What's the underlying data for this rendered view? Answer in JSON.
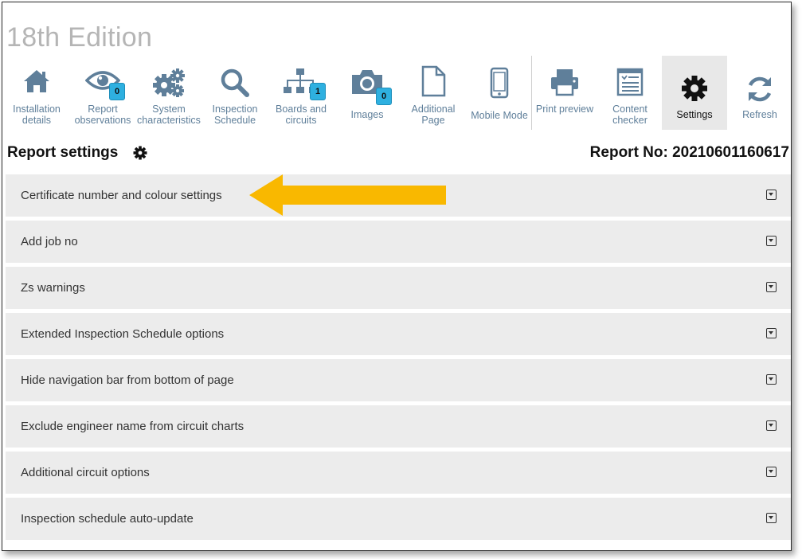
{
  "app": {
    "edition": "18th Edition"
  },
  "toolbar": {
    "items": [
      {
        "id": "installation",
        "label": "Installation details",
        "icon": "home-icon"
      },
      {
        "id": "observations",
        "label": "Report observations",
        "icon": "eye-icon",
        "badge": "0"
      },
      {
        "id": "system",
        "label": "System characteristics",
        "icon": "gears-icon"
      },
      {
        "id": "inspection",
        "label": "Inspection Schedule",
        "icon": "search-icon"
      },
      {
        "id": "boards",
        "label": "Boards and circuits",
        "icon": "sitemap-icon",
        "badge": "1"
      },
      {
        "id": "images",
        "label": "Images",
        "icon": "camera-icon",
        "badge": "0"
      },
      {
        "id": "additional",
        "label": "Additional Page",
        "icon": "page-icon"
      },
      {
        "id": "mobile",
        "label": "Mobile Mode",
        "icon": "mobile-icon"
      },
      {
        "id": "print",
        "label": "Print preview",
        "icon": "printer-icon"
      },
      {
        "id": "content",
        "label": "Content checker",
        "icon": "checklist-icon"
      },
      {
        "id": "settings",
        "label": "Settings",
        "icon": "gear-icon",
        "active": true
      },
      {
        "id": "refresh",
        "label": "Refresh",
        "icon": "refresh-icon"
      }
    ],
    "accent_color": "#5f7f9a",
    "badge_color": "#2eb0e0"
  },
  "page": {
    "title": "Report settings",
    "report_no": "Report No: 20210601160617"
  },
  "settings_sections": [
    "Certificate number and colour settings",
    "Add job no",
    "Zs warnings",
    "Extended Inspection Schedule options",
    "Hide navigation bar from bottom of page",
    "Exclude engineer name from circuit charts",
    "Additional circuit options",
    "Inspection schedule auto-update"
  ],
  "annotation": {
    "arrow_color": "#f9b800",
    "target": "Certificate number and colour settings"
  }
}
